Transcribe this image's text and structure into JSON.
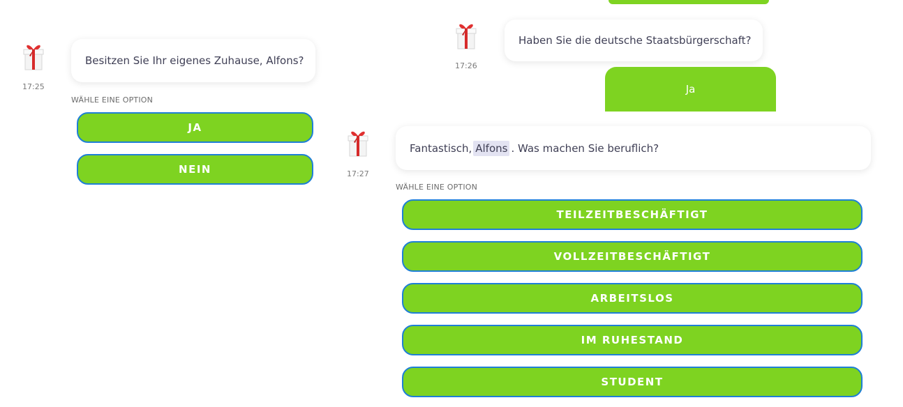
{
  "left_column": {
    "bot_message": "Besitzen Sie Ihr eigenes Zuhause, Alfons?",
    "time": "17:25",
    "option_label": "WÄHLE EINE OPTION",
    "options": [
      "JA",
      "NEIN"
    ]
  },
  "right_column": {
    "bot_message_1": "Haben Sie die deutsche Staatsbürgerschaft?",
    "time_1": "17:26",
    "user_reply": "Ja",
    "bot_message_2": {
      "prefix": "Fantastisch,",
      "name": "Alfons",
      "suffix": ". Was machen Sie beruflich?"
    },
    "time_2": "17:27",
    "option_label": "WÄHLE EINE OPTION",
    "options": [
      "TEILZEITBESCHÄFTIGT",
      "VOLLZEITBESCHÄFTIGT",
      "ARBEITSLOS",
      "IM RUHESTAND",
      "STUDENT"
    ]
  },
  "icons": {
    "avatar": "gift-icon"
  },
  "colors": {
    "accent_green": "#7ed321",
    "button_border": "#1e7fd6",
    "text": "#3f3f55"
  }
}
